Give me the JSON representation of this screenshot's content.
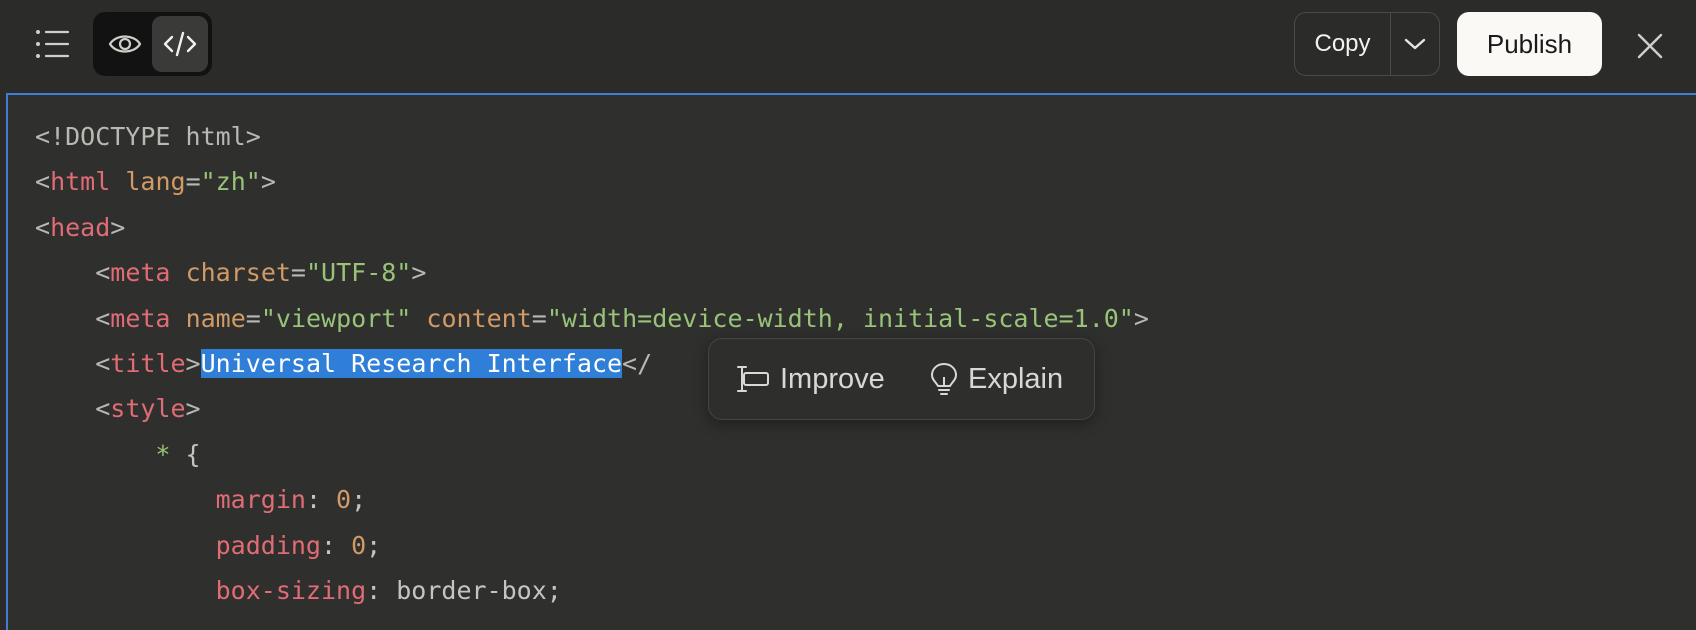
{
  "toolbar": {
    "list_icon": "list-icon",
    "preview_icon": "eye-icon",
    "code_icon": "code-icon",
    "copy_label": "Copy",
    "copy_dropdown_icon": "chevron-down-icon",
    "publish_label": "Publish",
    "close_icon": "close-icon"
  },
  "colors": {
    "background": "#2b2b2a",
    "selection": "#2f7ed8",
    "tag": "#e06c75",
    "attribute": "#d19a66",
    "string": "#98c379",
    "publish_bg": "#faf9f5"
  },
  "code": {
    "lines": [
      [
        [
          "punc",
          "<!DOCTYPE html>"
        ]
      ],
      [
        [
          "punc",
          "<"
        ],
        [
          "tag",
          "html"
        ],
        [
          "plain",
          " "
        ],
        [
          "attr",
          "lang"
        ],
        [
          "punc",
          "="
        ],
        [
          "str",
          "\"zh\""
        ],
        [
          "punc",
          ">"
        ]
      ],
      [
        [
          "punc",
          "<"
        ],
        [
          "tag",
          "head"
        ],
        [
          "punc",
          ">"
        ]
      ],
      [
        [
          "plain",
          "    "
        ],
        [
          "punc",
          "<"
        ],
        [
          "tag",
          "meta"
        ],
        [
          "plain",
          " "
        ],
        [
          "attr",
          "charset"
        ],
        [
          "punc",
          "="
        ],
        [
          "str",
          "\"UTF-8\""
        ],
        [
          "punc",
          ">"
        ]
      ],
      [
        [
          "plain",
          "    "
        ],
        [
          "punc",
          "<"
        ],
        [
          "tag",
          "meta"
        ],
        [
          "plain",
          " "
        ],
        [
          "attr",
          "name"
        ],
        [
          "punc",
          "="
        ],
        [
          "str",
          "\"viewport\""
        ],
        [
          "plain",
          " "
        ],
        [
          "attr",
          "content"
        ],
        [
          "punc",
          "="
        ],
        [
          "str",
          "\"width=device-width, initial-scale=1.0\""
        ],
        [
          "punc",
          ">"
        ]
      ],
      [
        [
          "plain",
          "    "
        ],
        [
          "punc",
          "<"
        ],
        [
          "tag",
          "title"
        ],
        [
          "punc",
          ">"
        ],
        [
          "hl",
          "Universal Research Interface"
        ],
        [
          "punc",
          "</"
        ]
      ],
      [
        [
          "plain",
          "    "
        ],
        [
          "punc",
          "<"
        ],
        [
          "tag",
          "style"
        ],
        [
          "punc",
          ">"
        ]
      ],
      [
        [
          "plain",
          "        "
        ],
        [
          "sel",
          "*"
        ],
        [
          "plain",
          " {"
        ]
      ],
      [
        [
          "plain",
          "            "
        ],
        [
          "prop",
          "margin"
        ],
        [
          "plain",
          ": "
        ],
        [
          "num",
          "0"
        ],
        [
          "plain",
          ";"
        ]
      ],
      [
        [
          "plain",
          "            "
        ],
        [
          "prop",
          "padding"
        ],
        [
          "plain",
          ": "
        ],
        [
          "num",
          "0"
        ],
        [
          "plain",
          ";"
        ]
      ],
      [
        [
          "plain",
          "            "
        ],
        [
          "prop",
          "box-sizing"
        ],
        [
          "plain",
          ": border-box;"
        ]
      ]
    ]
  },
  "popover": {
    "improve_label": "Improve",
    "improve_icon": "text-cursor-icon",
    "explain_label": "Explain",
    "explain_icon": "lightbulb-icon"
  }
}
